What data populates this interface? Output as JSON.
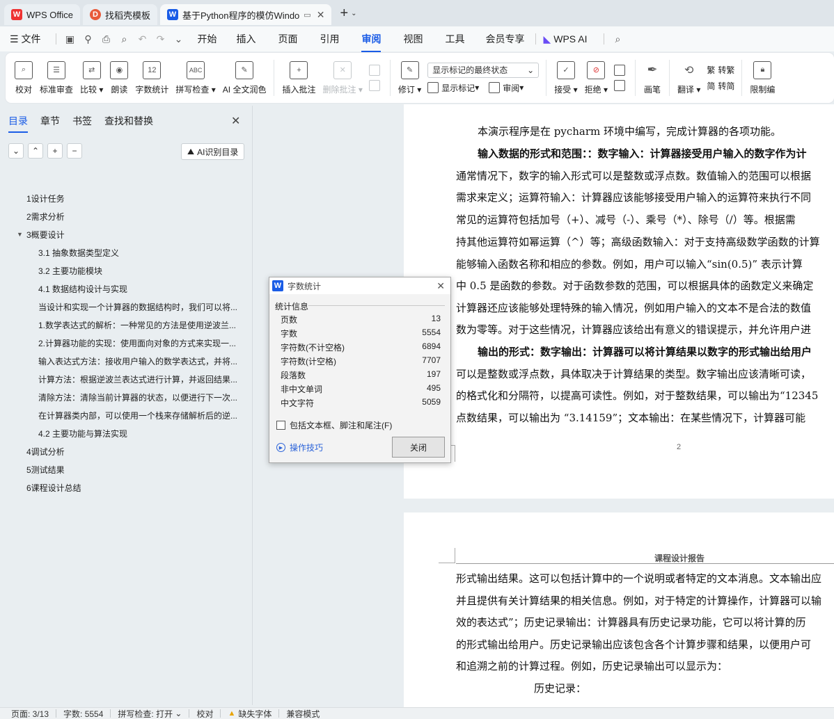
{
  "tabs": [
    {
      "label": "WPS Office",
      "icon": "wps-logo-icon",
      "active": false
    },
    {
      "label": "找稻壳模板",
      "icon": "docer-logo-icon",
      "active": false
    },
    {
      "label": "基于Python程序的模仿Windo",
      "icon": "writer-logo-icon",
      "active": true
    }
  ],
  "menu": {
    "file": "文件",
    "tabs": [
      "开始",
      "插入",
      "页面",
      "引用",
      "审阅",
      "视图",
      "工具",
      "会员专享"
    ],
    "active_tab": "审阅",
    "wps_ai": "WPS AI"
  },
  "ribbon": {
    "proofread": "校对",
    "standard_review": "标准审查",
    "compare": "比较",
    "read_aloud": "朗读",
    "word_count": "字数统计",
    "spell_check": "拼写检查",
    "ai_polish": "AI 全文润色",
    "insert_comment": "插入批注",
    "delete_comment": "删除批注",
    "revise": "修订",
    "markup_select": "显示标记的最终状态",
    "show_markup": "显示标记",
    "review_pane": "审阅",
    "accept": "接受",
    "reject": "拒绝",
    "ink": "画笔",
    "translate": "翻译",
    "to_traditional": "转繁",
    "to_simplified": "转简",
    "restrict_edit": "限制编"
  },
  "sidebar": {
    "tabs": [
      "目录",
      "章节",
      "书签",
      "查找和替换"
    ],
    "active_tab": "目录",
    "ai_toc": "AI识别目录",
    "toc": [
      {
        "level": 1,
        "text": "1设计任务"
      },
      {
        "level": 1,
        "text": "2需求分析"
      },
      {
        "level": 1,
        "text": "3概要设计",
        "expanded": true
      },
      {
        "level": 2,
        "text": "3.1 抽象数据类型定义"
      },
      {
        "level": 2,
        "text": "3.2  主要功能模块"
      },
      {
        "level": 2,
        "text": "4.1  数据结构设计与实现"
      },
      {
        "level": 2,
        "text": "当设计和实现一个计算器的数据结构时，我们可以将..."
      },
      {
        "level": 2,
        "text": "1.数学表达式的解析：一种常见的方法是使用逆波兰..."
      },
      {
        "level": 2,
        "text": "2.计算器功能的实现：使用面向对象的方式来实现一..."
      },
      {
        "level": 2,
        "text": "输入表达式方法：接收用户输入的数学表达式，并将..."
      },
      {
        "level": 2,
        "text": "计算方法：根据逆波兰表达式进行计算，并返回结果..."
      },
      {
        "level": 2,
        "text": "清除方法：清除当前计算器的状态，以便进行下一次..."
      },
      {
        "level": 2,
        "text": "在计算器类内部，可以使用一个栈来存储解析后的逆..."
      },
      {
        "level": 2,
        "text": "4.2  主要功能与算法实现"
      },
      {
        "level": 1,
        "text": "4调试分析"
      },
      {
        "level": 1,
        "text": "5测试结果"
      },
      {
        "level": 1,
        "text": "6课程设计总结"
      }
    ]
  },
  "document": {
    "page1_lines": [
      "本演示程序是在 pycharm 环境中编写，完成计算器的各项功能。",
      "输入数据的形式和范围：：数字输入：计算器接受用户输入的数字作为计",
      "通常情况下，数字的输入形式可以是整数或浮点数。数值输入的范围可以根据",
      "需求来定义；运算符输入：计算器应该能够接受用户输入的运算符来执行不同",
      "常见的运算符包括加号（+）、减号（-）、乘号（*）、除号（/）等。根据需",
      "持其他运算符如幂运算（^）等；高级函数输入：对于支持高级数学函数的计算",
      "能够输入函数名称和相应的参数。例如，用户可以输入“sin(0.5)” 表示计算",
      "中 0.5 是函数的参数。对于函数参数的范围，可以根据具体的函数定义来确定",
      "计算器还应该能够处理特殊的输入情况，例如用户输入的文本不是合法的数值",
      "数为零等。对于这些情况，计算器应该给出有意义的错误提示，并允许用户进",
      "输出的形式：数字输出：计算器可以将计算结果以数字的形式输出给用户",
      "可以是整数或浮点数，具体取决于计算结果的类型。数字输出应该清晰可读，",
      "的格式化和分隔符，以提高可读性。例如，对于整数结果，可以输出为“12345",
      "点数结果，可以输出为 “3.14159”；文本输出：在某些情况下，计算器可能"
    ],
    "page_number": "2",
    "page2_header": "课程设计报告",
    "page2_lines": [
      "形式输出结果。这可以包括计算中的一个说明或者特定的文本消息。文本输出应",
      "并且提供有关计算结果的相关信息。例如，对于特定的计算操作，计算器可以输",
      "效的表达式”；历史记录输出：计算器具有历史记录功能，它可以将计算的历",
      "的形式输出给用户。历史记录输出应该包含各个计算步骤和结果，以便用户可",
      "和追溯之前的计算过程。例如，历史记录输出可以显示为：",
      "历史记录："
    ]
  },
  "word_count_dialog": {
    "title": "字数统计",
    "section": "统计信息",
    "stats": [
      {
        "label": "页数",
        "value": "13"
      },
      {
        "label": "字数",
        "value": "5554"
      },
      {
        "label": "字符数(不计空格)",
        "value": "6894"
      },
      {
        "label": "字符数(计空格)",
        "value": "7707"
      },
      {
        "label": "段落数",
        "value": "197"
      },
      {
        "label": "非中文单词",
        "value": "495"
      },
      {
        "label": "中文字符",
        "value": "5059"
      }
    ],
    "checkbox": "包括文本框、脚注和尾注(F)",
    "tips": "操作技巧",
    "close": "关闭"
  },
  "status": {
    "page": "页面: 3/13",
    "words": "字数: 5554",
    "spell": "拼写检查: 打开",
    "proof": "校对",
    "missing_font": "缺失字体",
    "compat": "兼容模式"
  }
}
